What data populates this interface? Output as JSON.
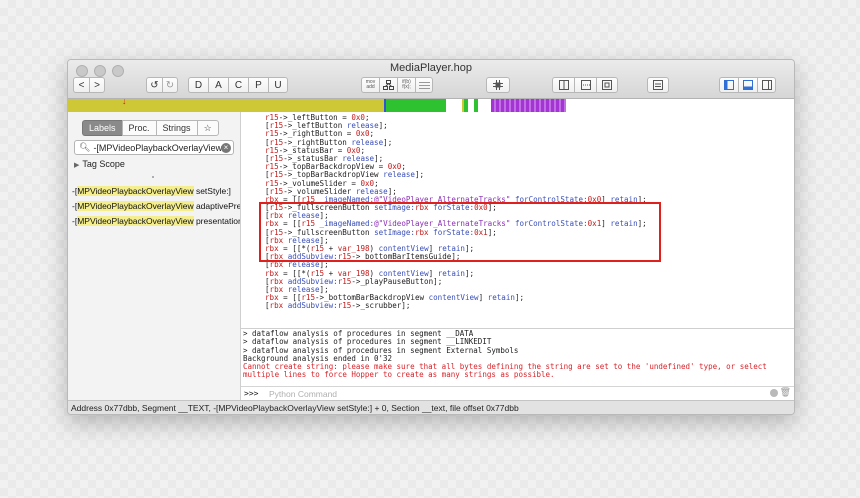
{
  "window": {
    "title": "MediaPlayer.hop"
  },
  "toolbar": {
    "back_label": "<",
    "forward_label": ">",
    "undo_label": "↺",
    "redo_label": "↻",
    "letters": [
      "D",
      "A",
      "C",
      "P",
      "U"
    ],
    "mode_asm_top": "mov",
    "mode_asm_bottom": "add",
    "mode_pseudo_top": "if(b)",
    "mode_pseudo_bottom": "f(x);"
  },
  "navbar": {
    "accent_colors": {
      "base": "#cfc836",
      "green": "#2ec230",
      "purple": "#a534d4",
      "blue": "#2f54d6"
    }
  },
  "sidebar": {
    "tabs": [
      "Labels",
      "Proc.",
      "Strings",
      "☆"
    ],
    "search_value": "-[MPVideoPlaybackOverlayView",
    "scope_label": "Tag Scope",
    "procedures": [
      {
        "pre": "-[",
        "hl": "MPVideoPlaybackOverlayView",
        "post": " setStyle:]"
      },
      {
        "pre": "-[",
        "hl": "MPVideoPlaybackOverlayView",
        "post": " adaptivePre"
      },
      {
        "pre": "-[",
        "hl": "MPVideoPlaybackOverlayView",
        "post": " presentation"
      }
    ]
  },
  "code": {
    "lines": [
      "r15->_leftButton = 0x0;",
      "[r15->_leftButton release];",
      "r15->_rightButton = 0x0;",
      "[r15->_rightButton release];",
      "r15->_statusBar = 0x0;",
      "[r15->_statusBar release];",
      "r15->_topBarBackdropView = 0x0;",
      "[r15->_topBarBackdropView release];",
      "r15->_volumeSlider = 0x0;",
      "[r15->_volumeSlider release];",
      "rbx = [[r15 _imageNamed:@\"VideoPlayer_AlternateTracks\" forControlState:0x0] retain];",
      "[r15->_fullscreenButton setImage:rbx forState:0x0];",
      "[rbx release];",
      "rbx = [[r15 _imageNamed:@\"VideoPlayer_AlternateTracks\" forControlState:0x1] retain];",
      "[r15->_fullscreenButton setImage:rbx forState:0x1];",
      "[rbx release];",
      "rbx = [[*(r15 + var_198) contentView] retain];",
      "[rbx addSubview:r15->_bottomBarItemsGuide];",
      "[rbx release];",
      "rbx = [[*(r15 + var_198) contentView] retain];",
      "[rbx addSubview:r15->_playPauseButton];",
      "[rbx release];",
      "rbx = [[r15->_bottomBarBackdropView contentView] retain];",
      "[rbx addSubview:r15->_scrubber];"
    ]
  },
  "console": {
    "lines": [
      "> dataflow analysis of procedures in segment __DATA",
      "> dataflow analysis of procedures in segment __LINKEDIT",
      "> dataflow analysis of procedures in segment External Symbols",
      "Background analysis ended in 0'32"
    ],
    "error_line1": "Cannot create string: please make sure that all bytes defining the string are set to the 'undefined' type, or select",
    "error_line2": "multiple lines to force Hopper to create as many strings as possible.",
    "prompt": ">>>",
    "python_placeholder": "Python Command"
  },
  "status": {
    "text": "Address 0x77dbb, Segment __TEXT, -[MPVideoPlaybackOverlayView setStyle:] + 0, Section __text, file offset 0x77dbb"
  }
}
